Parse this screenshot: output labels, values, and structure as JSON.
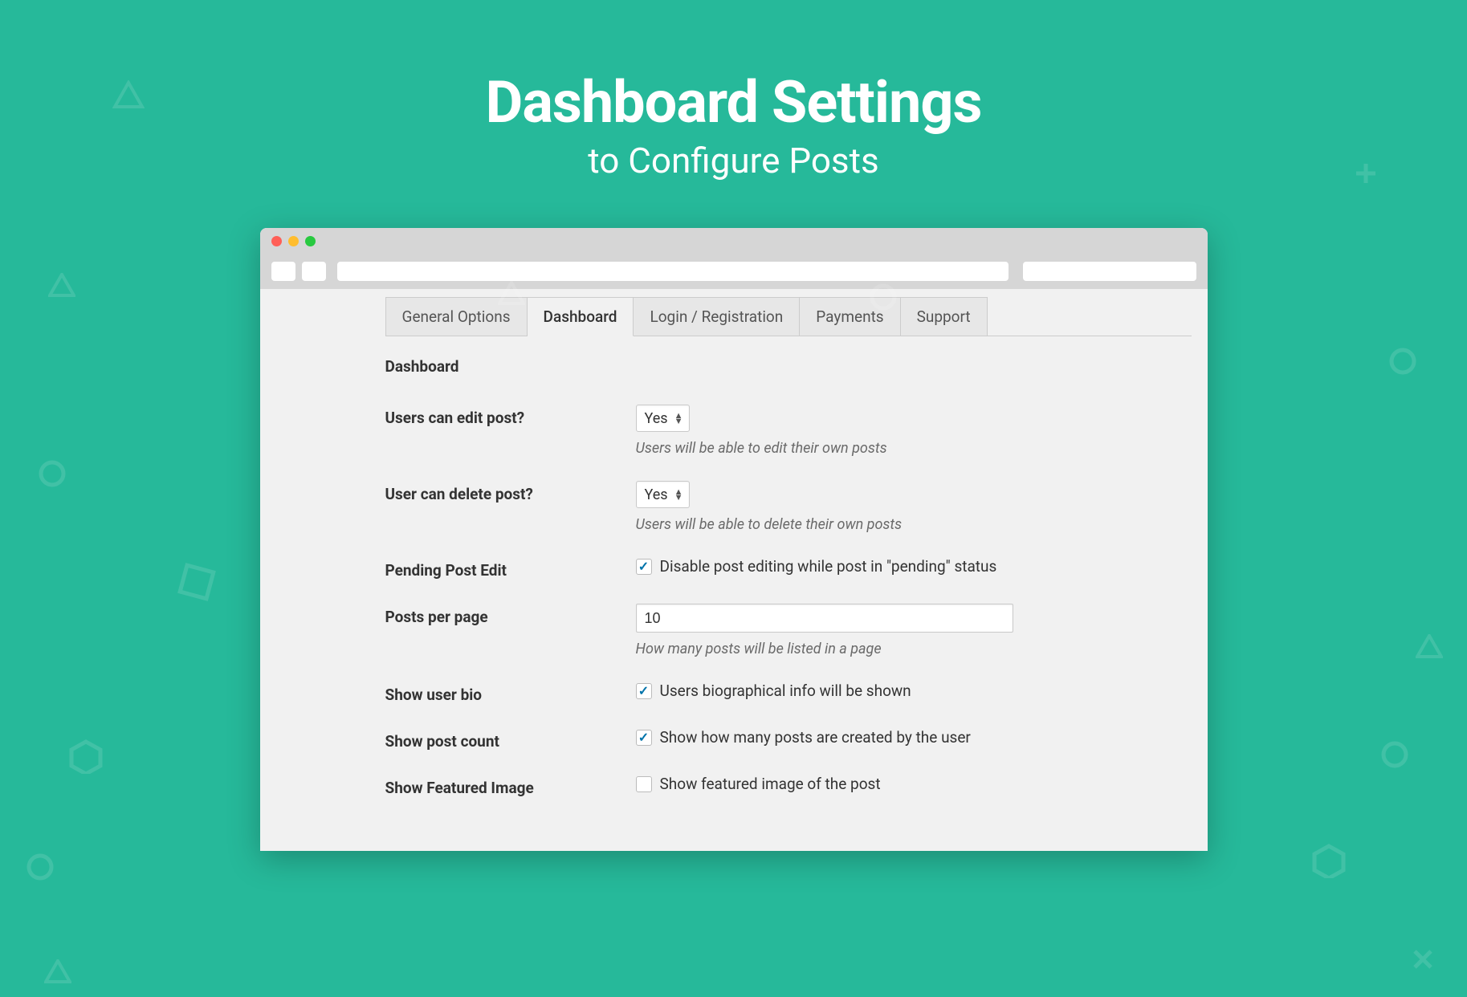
{
  "hero": {
    "title": "Dashboard Settings",
    "subtitle": "to Configure Posts"
  },
  "tabs": [
    {
      "label": "General Options",
      "active": false
    },
    {
      "label": "Dashboard",
      "active": true
    },
    {
      "label": "Login / Registration",
      "active": false
    },
    {
      "label": "Payments",
      "active": false
    },
    {
      "label": "Support",
      "active": false
    }
  ],
  "section_title": "Dashboard",
  "fields": {
    "edit_post": {
      "label": "Users can edit post?",
      "value": "Yes",
      "help": "Users will be able to edit their own posts"
    },
    "delete_post": {
      "label": "User can delete post?",
      "value": "Yes",
      "help": "Users will be able to delete their own posts"
    },
    "pending_edit": {
      "label": "Pending Post Edit",
      "checked": true,
      "text": "Disable post editing while post in \"pending\" status"
    },
    "posts_per_page": {
      "label": "Posts per page",
      "value": "10",
      "help": "How many posts will be listed in a page"
    },
    "show_bio": {
      "label": "Show user bio",
      "checked": true,
      "text": "Users biographical info will be shown"
    },
    "show_count": {
      "label": "Show post count",
      "checked": true,
      "text": "Show how many posts are created by the user"
    },
    "show_featured": {
      "label": "Show Featured Image",
      "checked": false,
      "text": "Show featured image of the post"
    }
  }
}
